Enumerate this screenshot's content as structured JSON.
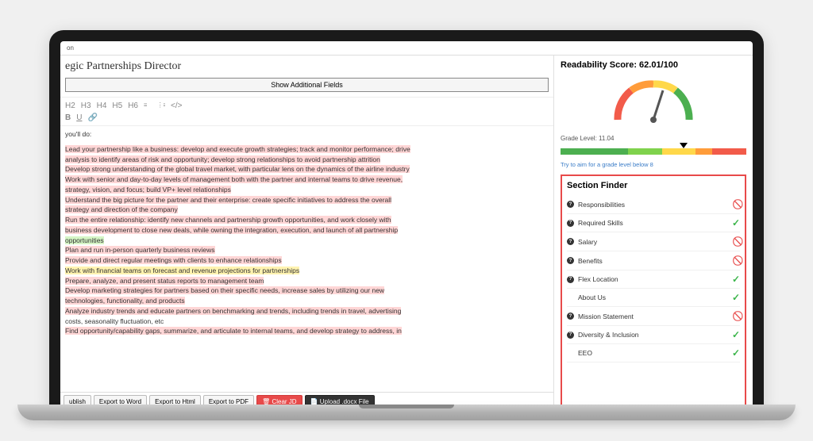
{
  "topbar": {
    "crumb": "on"
  },
  "job": {
    "title": "egic Partnerships Director",
    "additional_fields_label": "Show Additional Fields",
    "intro": "you'll do:",
    "bullets": [
      {
        "text": "Lead your partnership like a business: develop and execute growth strategies; track and monitor performance; drive",
        "hl": "red"
      },
      {
        "text": "analysis to identify areas of risk and opportunity; develop strong relationships to avoid partnership attrition",
        "hl": "red"
      },
      {
        "text": "Develop strong understanding of the global travel market, with particular lens on the dynamics of the airline industry",
        "hl": "red"
      },
      {
        "text": "Work with senior and day-to-day levels of management both with the partner and internal teams to drive revenue,",
        "hl": "red"
      },
      {
        "text": "strategy, vision, and focus; build VP+ level relationships",
        "hl": "red"
      },
      {
        "text": "Understand the big picture for the partner and their enterprise: create specific initiatives to address the overall",
        "hl": "red"
      },
      {
        "text": "strategy and direction of the company",
        "hl": "red"
      },
      {
        "text": "Run the entire relationship: identify new channels and partnership growth opportunities, and work closely with",
        "hl": "red"
      },
      {
        "text": "business development to close new deals, while owning the integration, execution, and launch of all partnership",
        "hl": "red"
      },
      {
        "text": "opportunities",
        "hl": "green"
      },
      {
        "text": "Plan and run in-person quarterly business reviews",
        "hl": "red"
      },
      {
        "text": "Provide and direct regular meetings with clients to enhance relationships",
        "hl": "red"
      },
      {
        "text": "Work with financial teams on forecast and revenue projections for partnerships",
        "hl": "yellow"
      },
      {
        "text": "Prepare, analyze, and present status reports to management team",
        "hl": "red"
      },
      {
        "text": "Develop marketing strategies for partners based on their specific needs, increase sales by utilizing our new",
        "hl": "red"
      },
      {
        "text": "technologies, functionality, and products",
        "hl": "red"
      },
      {
        "text": "Analyze industry trends and educate partners on benchmarking and trends, including trends in travel, advertising",
        "hl": "red"
      },
      {
        "text": "costs, seasonality fluctuation, etc",
        "hl": "none"
      },
      {
        "text": "Find opportunity/capability gaps, summarize, and articulate to internal teams, and develop strategy to address, in",
        "hl": "red"
      }
    ]
  },
  "toolbar": {
    "headings": [
      "H2",
      "H3",
      "H4",
      "H5",
      "H6"
    ],
    "bold": "B",
    "underline": "U",
    "link": "🔗"
  },
  "actions": {
    "publish": "ublish",
    "export_word": "Export to Word",
    "export_html": "Export to Html",
    "export_pdf": "Export to PDF",
    "clear": "Clear JD",
    "upload": "Upload .docx File"
  },
  "readability": {
    "title": "Readability Score: 62.01/100",
    "grade_label": "Grade Level: 11.04",
    "tip": "Try to aim for a grade level below 8"
  },
  "section_finder": {
    "title": "Section Finder",
    "items": [
      {
        "label": "Responsibilities",
        "q": true,
        "status": "no"
      },
      {
        "label": "Required Skills",
        "q": true,
        "status": "ok"
      },
      {
        "label": "Salary",
        "q": true,
        "status": "no"
      },
      {
        "label": "Benefits",
        "q": true,
        "status": "no"
      },
      {
        "label": "Flex Location",
        "q": true,
        "status": "ok"
      },
      {
        "label": "About Us",
        "q": false,
        "status": "ok"
      },
      {
        "label": "Mission Statement",
        "q": true,
        "status": "no"
      },
      {
        "label": "Diversity & Inclusion",
        "q": true,
        "status": "ok"
      },
      {
        "label": "EEO",
        "q": false,
        "status": "ok"
      }
    ]
  }
}
